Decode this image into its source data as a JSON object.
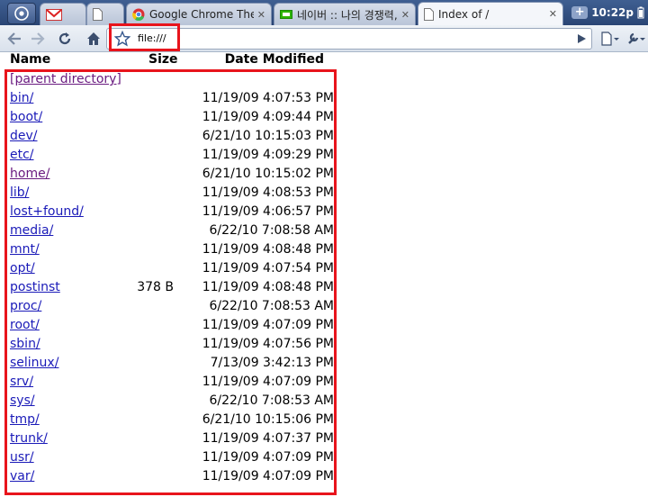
{
  "tabs": [
    {
      "title": "",
      "icon": "gmail-icon"
    },
    {
      "title": "",
      "icon": "page-icon"
    },
    {
      "title": "Google Chrome Them...",
      "icon": "chrome-icon"
    },
    {
      "title": "네이버 :: 나의 경쟁력, ...",
      "icon": "naver-icon"
    },
    {
      "title": "Index of /",
      "icon": "page-icon"
    }
  ],
  "status": {
    "clock": "10:22p",
    "new_tab": "+"
  },
  "omnibox": {
    "url": "file:///"
  },
  "listing": {
    "headers": {
      "name": "Name",
      "size": "Size",
      "date": "Date Modified"
    },
    "parent_label": "[parent directory]",
    "rows": [
      {
        "name": "bin/",
        "size": "",
        "date": "11/19/09 4:07:53 PM"
      },
      {
        "name": "boot/",
        "size": "",
        "date": "11/19/09 4:09:44 PM"
      },
      {
        "name": "dev/",
        "size": "",
        "date": "6/21/10 10:15:03 PM"
      },
      {
        "name": "etc/",
        "size": "",
        "date": "11/19/09 4:09:29 PM"
      },
      {
        "name": "home/",
        "size": "",
        "date": "6/21/10 10:15:02 PM"
      },
      {
        "name": "lib/",
        "size": "",
        "date": "11/19/09 4:08:53 PM"
      },
      {
        "name": "lost+found/",
        "size": "",
        "date": "11/19/09 4:06:57 PM"
      },
      {
        "name": "media/",
        "size": "",
        "date": "6/22/10 7:08:58 AM"
      },
      {
        "name": "mnt/",
        "size": "",
        "date": "11/19/09 4:08:48 PM"
      },
      {
        "name": "opt/",
        "size": "",
        "date": "11/19/09 4:07:54 PM"
      },
      {
        "name": "postinst",
        "size": "378 B",
        "date": "11/19/09 4:08:48 PM"
      },
      {
        "name": "proc/",
        "size": "",
        "date": "6/22/10 7:08:53 AM"
      },
      {
        "name": "root/",
        "size": "",
        "date": "11/19/09 4:07:09 PM"
      },
      {
        "name": "sbin/",
        "size": "",
        "date": "11/19/09 4:07:56 PM"
      },
      {
        "name": "selinux/",
        "size": "",
        "date": "7/13/09 3:42:13 PM"
      },
      {
        "name": "srv/",
        "size": "",
        "date": "11/19/09 4:07:09 PM"
      },
      {
        "name": "sys/",
        "size": "",
        "date": "6/22/10 7:08:53 AM"
      },
      {
        "name": "tmp/",
        "size": "",
        "date": "6/21/10 10:15:06 PM"
      },
      {
        "name": "trunk/",
        "size": "",
        "date": "11/19/09 4:07:37 PM"
      },
      {
        "name": "usr/",
        "size": "",
        "date": "11/19/09 4:07:09 PM"
      },
      {
        "name": "var/",
        "size": "",
        "date": "11/19/09 4:07:09 PM"
      }
    ]
  },
  "colors": {
    "link": "#1a1ab8",
    "visited_link": "#6a1b80",
    "highlight": "#e8141c",
    "tabbar": "#2a4574"
  }
}
